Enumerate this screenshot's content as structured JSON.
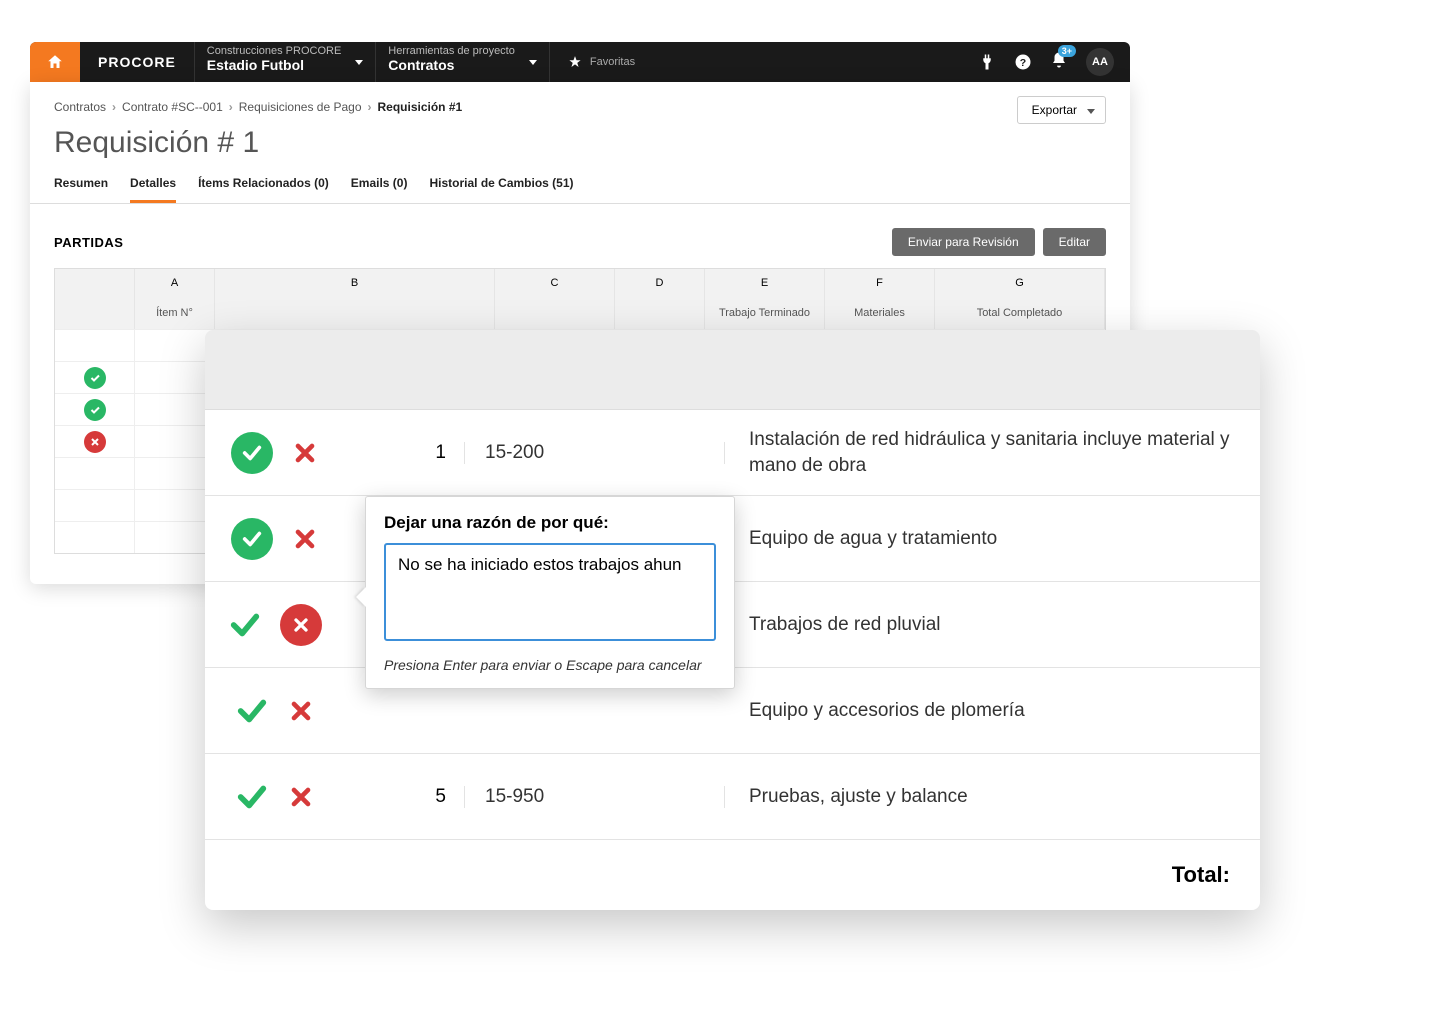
{
  "header": {
    "logo": "PROCORE",
    "company": {
      "label": "Construcciones PROCORE",
      "value": "Estadio Futbol"
    },
    "tool": {
      "label": "Herramientas de proyecto",
      "value": "Contratos"
    },
    "favorites": "Favoritas",
    "avatar": "AA",
    "notifications_badge": "3+"
  },
  "breadcrumbs": [
    "Contratos",
    "Contrato #SC--001",
    "Requisiciones de Pago",
    "Requisición #1"
  ],
  "export_label": "Exportar",
  "page_title": "Requisición # 1",
  "tabs": [
    "Resumen",
    "Detalles",
    "Ítems Relacionados (0)",
    "Emails (0)",
    "Historial de Cambios (51)"
  ],
  "active_tab": "Detalles",
  "section_title": "PARTIDAS",
  "buttons": {
    "review": "Enviar para Revisión",
    "edit": "Editar"
  },
  "bg_table": {
    "letters": [
      "A",
      "B",
      "C",
      "D",
      "E",
      "F",
      "G"
    ],
    "subheaders": {
      "item": "Ítem N°",
      "trabajo": "Trabajo Terminado",
      "materiales": "Materiales",
      "total": "Total Completado"
    },
    "status_rows": [
      "green",
      "green",
      "red"
    ]
  },
  "overlay_rows": [
    {
      "approved": "pill-green",
      "rejected": "x",
      "num": "1",
      "code": "15-200",
      "desc": "Instalación de red hidráulica y sanitaria incluye material y mano de obra"
    },
    {
      "approved": "pill-green",
      "rejected": "x",
      "num": "",
      "code": "",
      "desc": "Equipo de agua y tratamiento"
    },
    {
      "approved": "check",
      "rejected": "pill-red",
      "num": "",
      "code": "",
      "desc": "Trabajos de red pluvial"
    },
    {
      "approved": "check",
      "rejected": "x",
      "num": "",
      "code": "",
      "desc": "Equipo y accesorios de plomería"
    },
    {
      "approved": "check",
      "rejected": "x",
      "num": "5",
      "code": "15-950",
      "desc": "Pruebas, ajuste y balance"
    }
  ],
  "total_label": "Total:",
  "popover": {
    "label": "Dejar una razón de por qué:",
    "text": "No se ha iniciado estos trabajos ahun",
    "hint": "Presiona Enter para enviar o Escape para cancelar"
  }
}
